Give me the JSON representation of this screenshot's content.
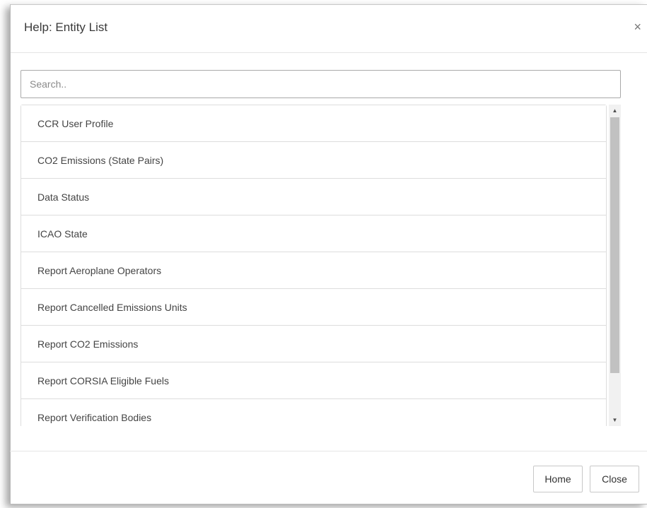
{
  "dialog": {
    "title": "Help: Entity List",
    "close_glyph": "×",
    "close_icon": "close-icon"
  },
  "search": {
    "placeholder": "Search..",
    "value": ""
  },
  "entities": [
    {
      "label": "CCR User Profile"
    },
    {
      "label": "CO2 Emissions (State Pairs)"
    },
    {
      "label": "Data Status"
    },
    {
      "label": "ICAO State"
    },
    {
      "label": "Report Aeroplane Operators"
    },
    {
      "label": "Report Cancelled Emissions Units"
    },
    {
      "label": "Report CO2 Emissions"
    },
    {
      "label": "Report CORSIA Eligible Fuels"
    },
    {
      "label": "Report Verification Bodies"
    }
  ],
  "scrollbar": {
    "up_glyph": "▲",
    "down_glyph": "▼"
  },
  "footer": {
    "home_label": "Home",
    "close_label": "Close"
  }
}
